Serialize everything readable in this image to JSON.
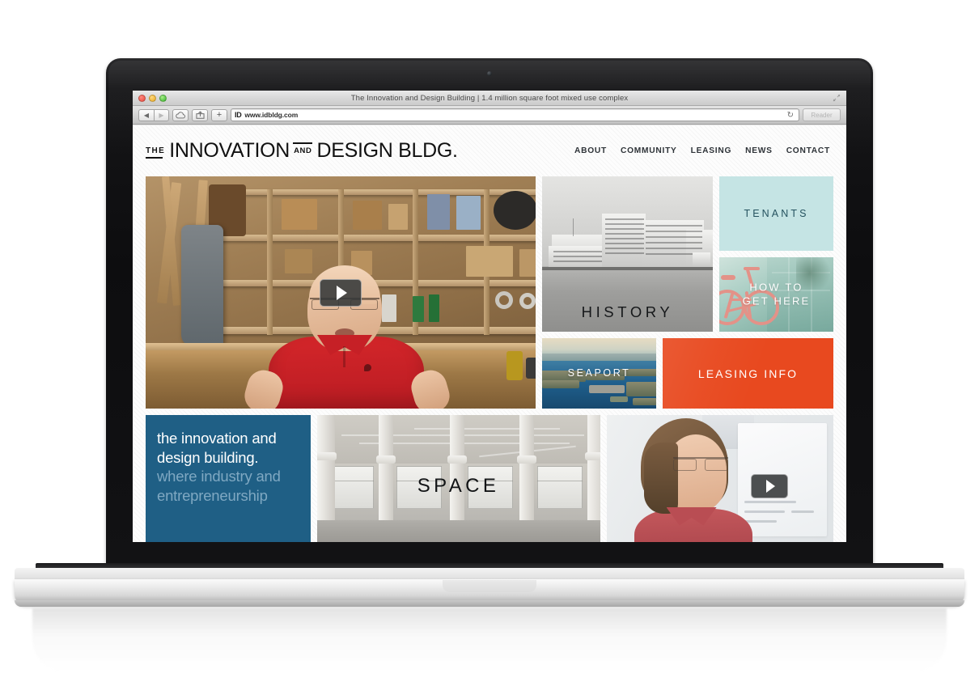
{
  "browser": {
    "window_title": "The Innovation and Design Building | 1.4 million square foot mixed use complex",
    "back_icon": "back-arrow-icon",
    "forward_icon": "forward-arrow-icon",
    "icloud_icon": "icloud-tabs-icon",
    "share_icon": "share-icon",
    "newtab_label": "+",
    "url_favicon": "ID",
    "url": "www.idbldg.com",
    "reload_icon": "reload-icon",
    "reader_label": "Reader",
    "fullscreen_icon": "fullscreen-icon",
    "traffic_lights": [
      "close",
      "minimize",
      "zoom"
    ]
  },
  "site": {
    "logo": {
      "the": "THE",
      "innovation": "INNOVATION",
      "and": "AND",
      "design_bldg": "DESIGN BLDG."
    },
    "nav": [
      {
        "label": "ABOUT"
      },
      {
        "label": "COMMUNITY"
      },
      {
        "label": "LEASING"
      },
      {
        "label": "NEWS"
      },
      {
        "label": "CONTACT"
      }
    ],
    "tiles": {
      "hero_video": {
        "name": "workshop-video",
        "play_label": "play"
      },
      "history": {
        "label": "HISTORY"
      },
      "tenants": {
        "label": "TENANTS"
      },
      "how_to_get_here": {
        "label": "HOW TO GET HERE",
        "line1": "HOW TO",
        "line2": "GET HERE"
      },
      "seaport": {
        "label": "SEAPORT"
      },
      "leasing_info": {
        "label": "LEASING INFO"
      },
      "space": {
        "label": "SPACE"
      },
      "intro": {
        "strong": "the innovation and design building.",
        "muted": " where industry and entrepreneurship"
      },
      "video2": {
        "name": "interview-video",
        "play_label": "play"
      }
    }
  },
  "colors": {
    "tenants_bg": "#c5e4e4",
    "tenants_text": "#25525f",
    "leasing_bg": "#e8491f",
    "intro_bg": "#1f5f85",
    "intro_muted_text": "#7fa8c2",
    "howto_bike": "#e39288",
    "nav_text": "#2e3338",
    "seaport_water": "#1f5f8c"
  }
}
